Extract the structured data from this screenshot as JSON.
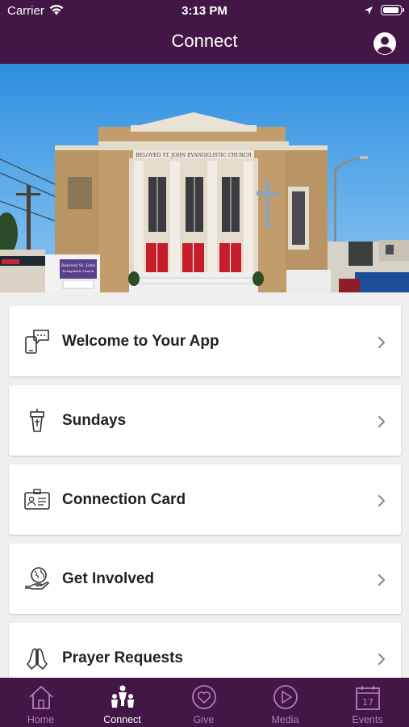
{
  "status_bar": {
    "carrier": "Carrier",
    "time": "3:13 PM"
  },
  "header": {
    "title": "Connect"
  },
  "hero": {
    "building_sign": "BELOVED ST. JOHN EVANGELISTIC CHURCH",
    "board_title": "Beloved St. John",
    "board_subtitle": "Evangelistic Church"
  },
  "menu": [
    {
      "label": "Welcome to Your App",
      "icon": "phone-chat-icon"
    },
    {
      "label": "Sundays",
      "icon": "pulpit-icon"
    },
    {
      "label": "Connection Card",
      "icon": "id-card-icon"
    },
    {
      "label": "Get Involved",
      "icon": "hand-globe-icon"
    },
    {
      "label": "Prayer Requests",
      "icon": "praying-hands-icon"
    }
  ],
  "tabs": [
    {
      "label": "Home",
      "icon": "home-icon",
      "active": false
    },
    {
      "label": "Connect",
      "icon": "people-icon",
      "active": true
    },
    {
      "label": "Give",
      "icon": "heart-circle-icon",
      "active": false
    },
    {
      "label": "Media",
      "icon": "play-circle-icon",
      "active": false
    },
    {
      "label": "Events",
      "icon": "calendar-icon",
      "active": false,
      "badge": "17"
    }
  ],
  "colors": {
    "brand": "#421645",
    "tab_inactive": "#b27cc0",
    "tab_active": "#ffffff",
    "background": "#efefef"
  }
}
